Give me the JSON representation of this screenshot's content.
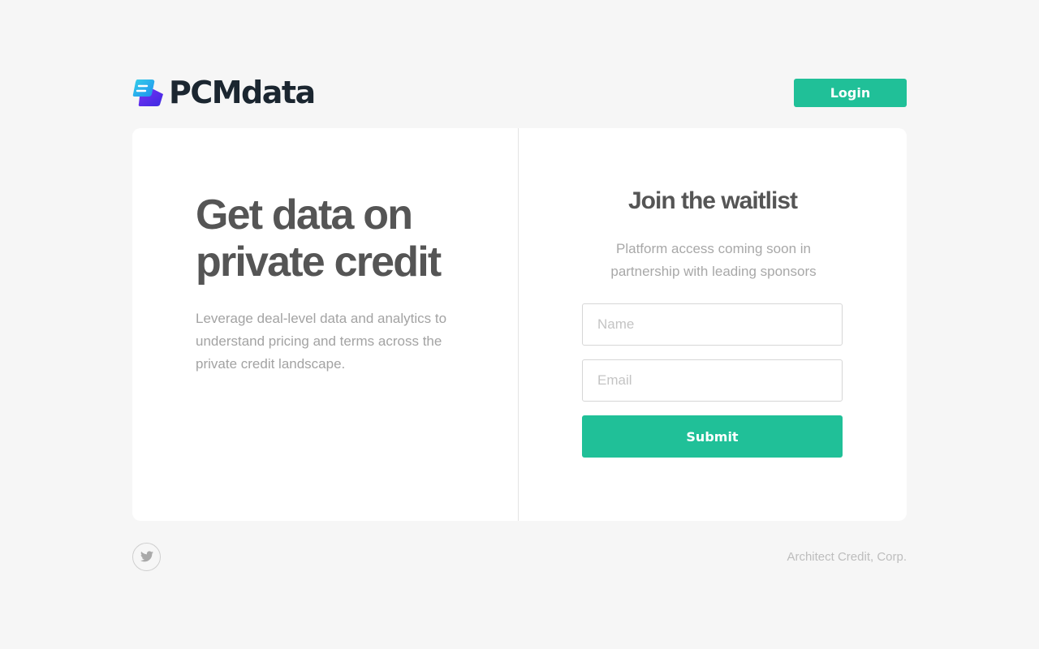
{
  "header": {
    "logo_text": "PCMdata",
    "login_label": "Login"
  },
  "hero": {
    "headline_line1": "Get data on",
    "headline_line2": "private credit",
    "lead": "Leverage deal-level data and analytics to understand pricing and terms across the private credit landscape."
  },
  "waitlist": {
    "title": "Join the waitlist",
    "subtitle": "Platform access coming soon in partnership with leading sponsors",
    "name_placeholder": "Name",
    "email_placeholder": "Email",
    "submit_label": "Submit"
  },
  "footer": {
    "social_icon": "twitter-icon",
    "company": "Architect Credit, Corp."
  },
  "colors": {
    "accent": "#20c098",
    "logo_dark": "#1b2630",
    "logo_cyan": "#2bb5e8",
    "logo_purple": "#5b2bf0"
  }
}
